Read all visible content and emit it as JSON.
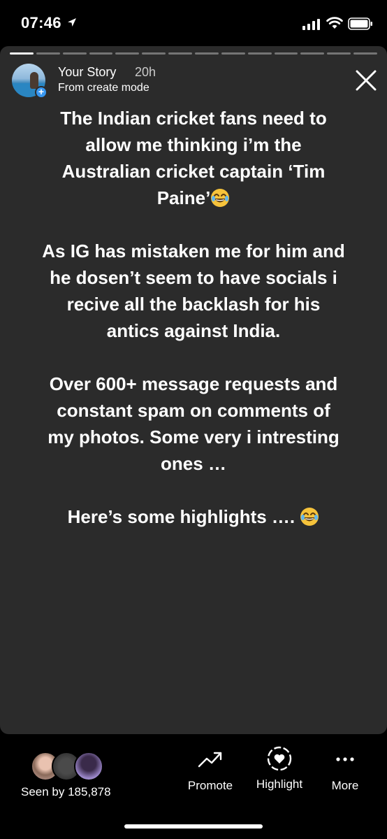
{
  "status_bar": {
    "time": "07:46"
  },
  "story": {
    "user": "Your Story",
    "age": "20h",
    "subtitle": "From create mode",
    "segments_total": 14,
    "segments_active": 1,
    "paragraphs": [
      "The Indian cricket fans need to allow me thinking i’m the Australian cricket captain ‘Tim Paine’",
      "As IG has mistaken me for him and he dosen’t seem to have socials i recive all the backlash for his antics against India.",
      "Over 600+ message requests and constant spam on comments of my photos. Some very i intresting ones …",
      "Here’s some highlights …."
    ]
  },
  "bottom_bar": {
    "seen_by": "Seen by 185,878",
    "promote_label": "Promote",
    "highlight_label": "Highlight",
    "more_label": "More"
  },
  "colors": {
    "story_bg": "#2b2b2b",
    "accent_blue": "#3897f0"
  }
}
